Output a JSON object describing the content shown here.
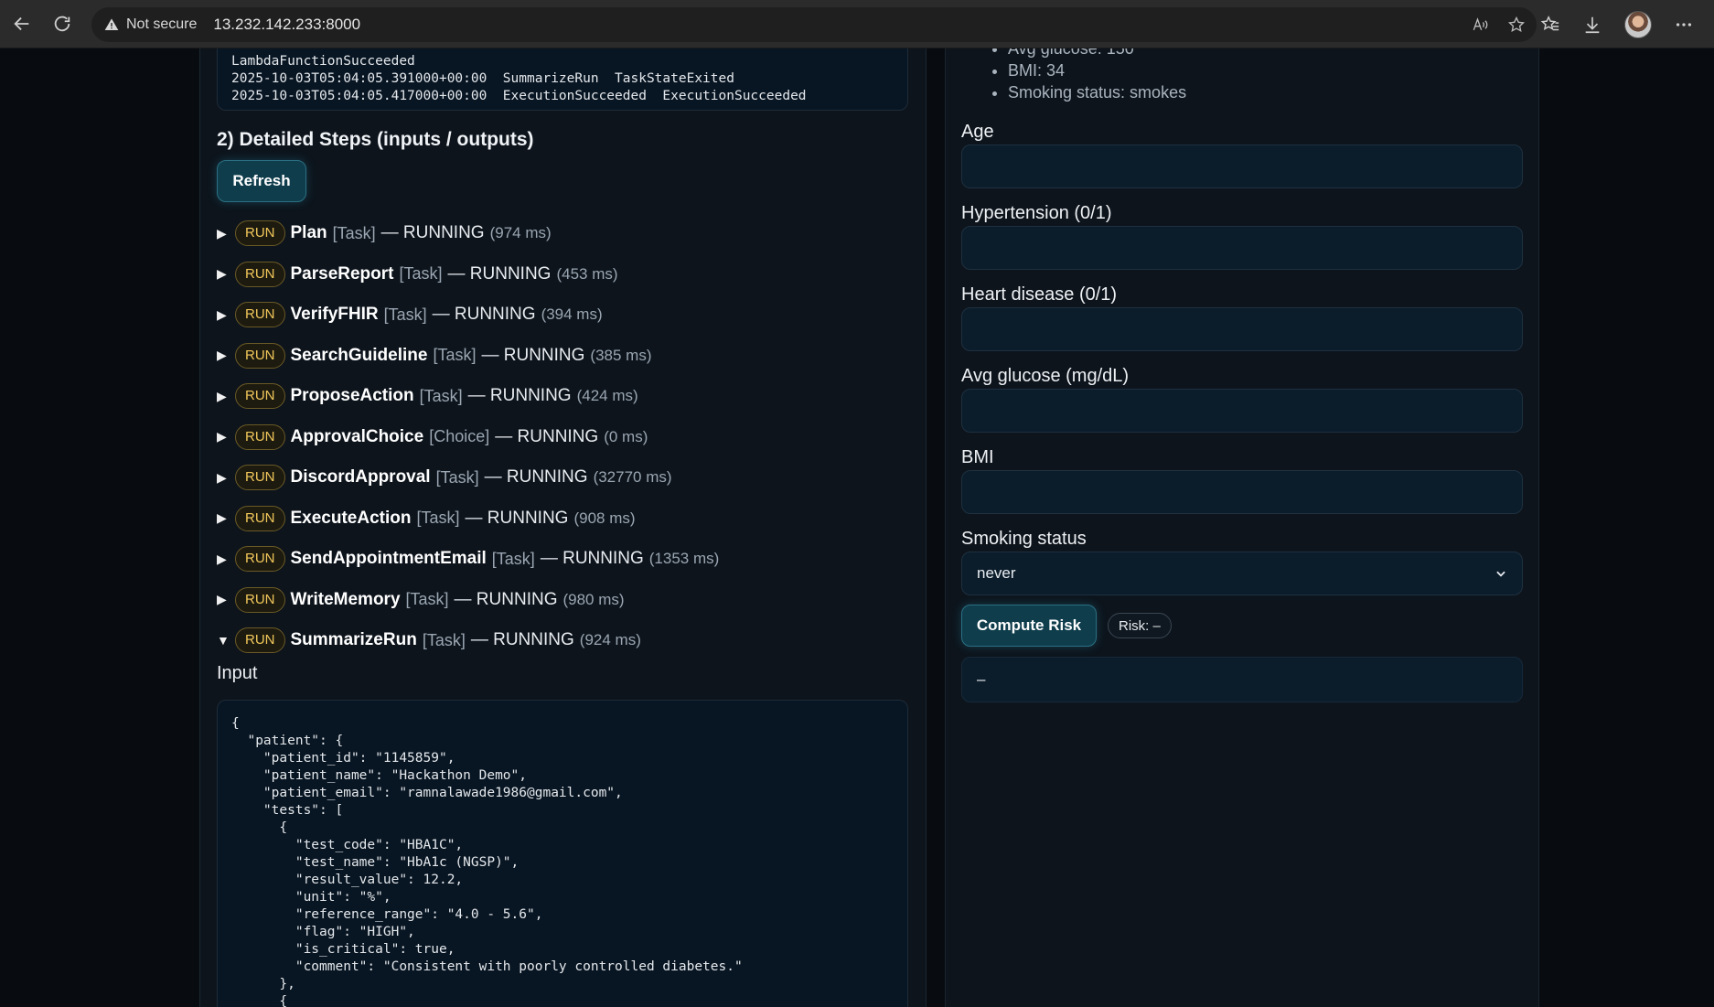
{
  "browser": {
    "security_label": "Not secure",
    "url": "13.232.142.233:8000"
  },
  "log": {
    "lines": [
      "LambdaFunctionSucceeded",
      "2025-10-03T05:04:05.391000+00:00  SummarizeRun  TaskStateExited",
      "2025-10-03T05:04:05.417000+00:00  ExecutionSucceeded  ExecutionSucceeded"
    ]
  },
  "steps_section": {
    "title": "2) Detailed Steps (inputs / outputs)",
    "refresh_label": "Refresh",
    "steps": [
      {
        "badge": "RUN",
        "name": "Plan",
        "type": "[Task]",
        "status": "— RUNNING",
        "ms": "(974 ms)",
        "expanded": false
      },
      {
        "badge": "RUN",
        "name": "ParseReport",
        "type": "[Task]",
        "status": "— RUNNING",
        "ms": "(453 ms)",
        "expanded": false
      },
      {
        "badge": "RUN",
        "name": "VerifyFHIR",
        "type": "[Task]",
        "status": "— RUNNING",
        "ms": "(394 ms)",
        "expanded": false
      },
      {
        "badge": "RUN",
        "name": "SearchGuideline",
        "type": "[Task]",
        "status": "— RUNNING",
        "ms": "(385 ms)",
        "expanded": false
      },
      {
        "badge": "RUN",
        "name": "ProposeAction",
        "type": "[Task]",
        "status": "— RUNNING",
        "ms": "(424 ms)",
        "expanded": false
      },
      {
        "badge": "RUN",
        "name": "ApprovalChoice",
        "type": "[Choice]",
        "status": "— RUNNING",
        "ms": "(0 ms)",
        "expanded": false
      },
      {
        "badge": "RUN",
        "name": "DiscordApproval",
        "type": "[Task]",
        "status": "— RUNNING",
        "ms": "(32770 ms)",
        "expanded": false
      },
      {
        "badge": "RUN",
        "name": "ExecuteAction",
        "type": "[Task]",
        "status": "— RUNNING",
        "ms": "(908 ms)",
        "expanded": false
      },
      {
        "badge": "RUN",
        "name": "SendAppointmentEmail",
        "type": "[Task]",
        "status": "— RUNNING",
        "ms": "(1353 ms)",
        "expanded": false
      },
      {
        "badge": "RUN",
        "name": "WriteMemory",
        "type": "[Task]",
        "status": "— RUNNING",
        "ms": "(980 ms)",
        "expanded": false
      },
      {
        "badge": "RUN",
        "name": "SummarizeRun",
        "type": "[Task]",
        "status": "— RUNNING",
        "ms": "(924 ms)",
        "expanded": true
      }
    ],
    "input_label": "Input",
    "input_json_lines": [
      "{",
      "  \"patient\": {",
      "    \"patient_id\": \"1145859\",",
      "    \"patient_name\": \"Hackathon Demo\",",
      "    \"patient_email\": \"ramnalawade1986@gmail.com\",",
      "    \"tests\": [",
      "      {",
      "        \"test_code\": \"HBA1C\",",
      "        \"test_name\": \"HbA1c (NGSP)\",",
      "        \"result_value\": 12.2,",
      "        \"unit\": \"%\",",
      "        \"reference_range\": \"4.0 - 5.6\",",
      "        \"flag\": \"HIGH\",",
      "        \"is_critical\": true,",
      "        \"comment\": \"Consistent with poorly controlled diabetes.\"",
      "      },",
      "      {"
    ]
  },
  "risk_form": {
    "facts": [
      "Avg glucose: 150",
      "BMI: 34",
      "Smoking status: smokes"
    ],
    "fields": [
      {
        "label": "Age",
        "value": ""
      },
      {
        "label": "Hypertension (0/1)",
        "value": ""
      },
      {
        "label": "Heart disease (0/1)",
        "value": ""
      },
      {
        "label": "Avg glucose (mg/dL)",
        "value": ""
      },
      {
        "label": "BMI",
        "value": ""
      }
    ],
    "smoking_label": "Smoking status",
    "smoking_selected": "never",
    "compute_label": "Compute Risk",
    "risk_pill": "Risk: –",
    "result_text": "–"
  },
  "colors": {
    "accent_button": "#0f3d4c",
    "run_badge_text": "#f2c85b",
    "panel_bg": "#0d141c"
  }
}
